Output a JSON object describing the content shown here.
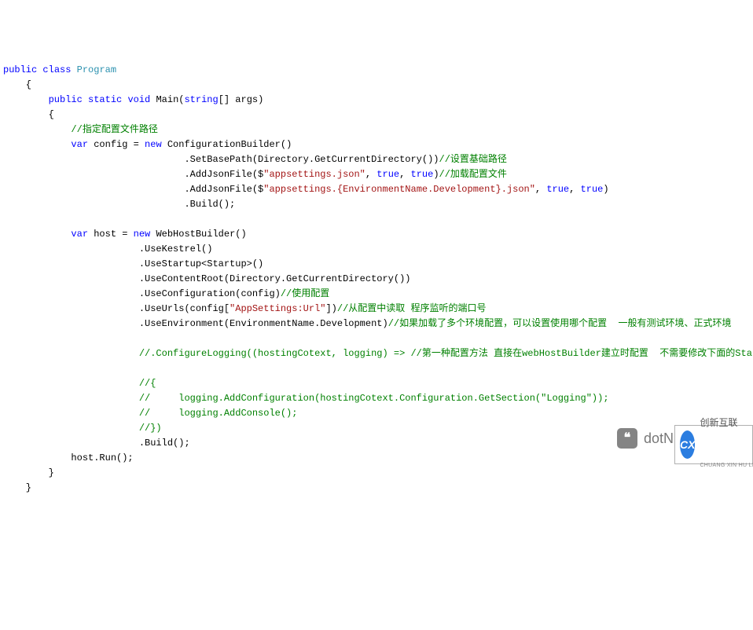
{
  "code": {
    "l1_kw1": "public",
    "l1_kw2": "class",
    "l1_type": "Program",
    "l2_brace": "    {",
    "l3_kw1": "public",
    "l3_kw2": "static",
    "l3_kw3": "void",
    "l3_name": " Main(",
    "l3_kw4": "string",
    "l3_tail": "[] args)",
    "l4_brace": "        {",
    "l5_cmt": "//指定配置文件路径",
    "l6_kw1": "var",
    "l6_txt1": " config = ",
    "l6_kw2": "new",
    "l6_txt2": " ConfigurationBuilder()",
    "l7_txt1": ".SetBasePath(Directory.GetCurrentDirectory())",
    "l7_cmt": "//设置基础路径",
    "l8_txt1": ".AddJsonFile($",
    "l8_str": "\"appsettings.json\"",
    "l8_txt2": ", ",
    "l8_kw1": "true",
    "l8_txt3": ", ",
    "l8_kw2": "true",
    "l8_txt4": ")",
    "l8_cmt": "//加载配置文件",
    "l9_txt1": ".AddJsonFile($",
    "l9_str": "\"appsettings.{EnvironmentName.Development}.json\"",
    "l9_txt2": ", ",
    "l9_kw1": "true",
    "l9_txt3": ", ",
    "l9_kw2": "true",
    "l9_txt4": ")",
    "l10_txt": ".Build();",
    "l11_kw1": "var",
    "l11_txt1": " host = ",
    "l11_kw2": "new",
    "l11_txt2": " WebHostBuilder()",
    "l12_txt": ".UseKestrel()",
    "l13_txt": ".UseStartup<Startup>()",
    "l14_txt": ".UseContentRoot(Directory.GetCurrentDirectory())",
    "l15_txt1": ".UseConfiguration(config)",
    "l15_cmt": "//使用配置",
    "l16_txt1": ".UseUrls(config[",
    "l16_str": "\"AppSettings:Url\"",
    "l16_txt2": "])",
    "l16_cmt": "//从配置中读取 程序监听的端口号",
    "l17_txt1": ".UseEnvironment(EnvironmentName.Development)",
    "l17_cmt": "//如果加载了多个环境配置，可以设置使用哪个配置  一般有测试环境、正式环境",
    "l18_cmt": "//.ConfigureLogging((hostingCotext, logging) => //第一种配置方法 直接在webHostBuilder建立时配置  不需要修改下面的Startup代码",
    "l19_cmt": "//{",
    "l20_cmt": "//     logging.AddConfiguration(hostingCotext.Configuration.GetSection(\"Logging\"));",
    "l21_cmt": "//     logging.AddConsole();",
    "l22_cmt": "//})",
    "l23_txt": ".Build();",
    "l24_txt": "host.Run();",
    "l25_brace": "        }",
    "l26_brace": "    }"
  },
  "watermark": {
    "icon_glyph": "❝",
    "text": "dotNET跨平台"
  },
  "badge": {
    "logo_text": "CX",
    "line1": "创新互联",
    "line2": "CHUANG XIN HU LIAN"
  }
}
